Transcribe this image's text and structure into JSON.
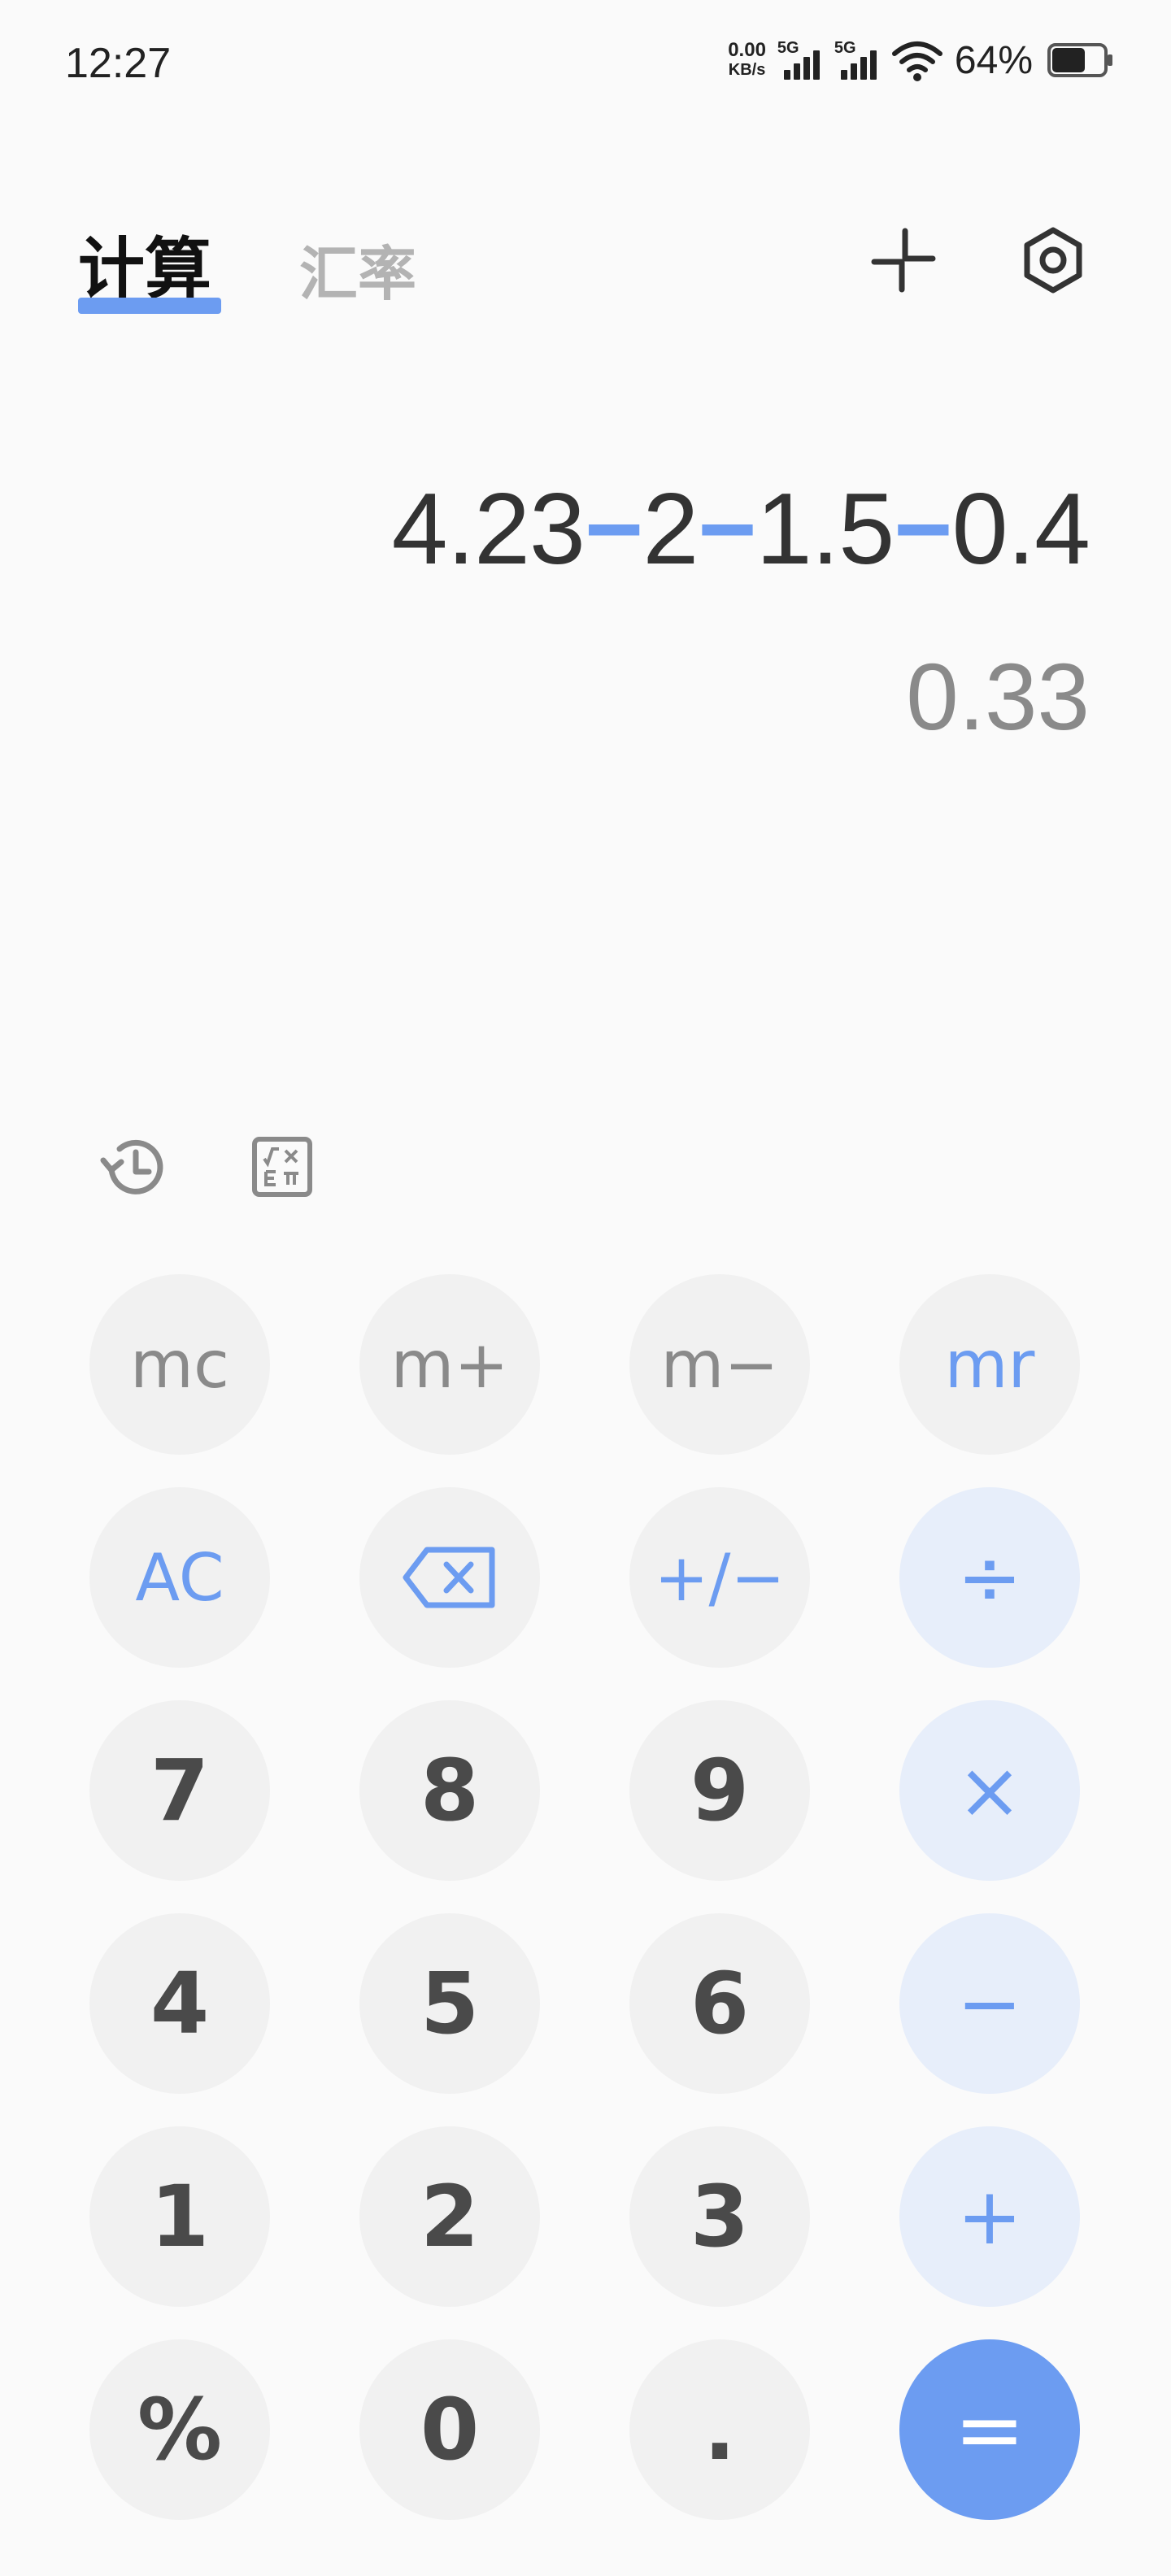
{
  "status_bar": {
    "time": "12:27",
    "net_speed_value": "0.00",
    "net_speed_unit": "KB/s",
    "sim1_label": "5G",
    "sim2_label": "5G",
    "battery_percent": "64%"
  },
  "header": {
    "tabs": [
      {
        "label": "计算",
        "active": true
      },
      {
        "label": "汇率",
        "active": false
      }
    ],
    "icons": [
      "collapse-icon",
      "settings-icon"
    ]
  },
  "display": {
    "expression_parts": [
      "4.23",
      "−",
      "2",
      "−",
      "1.5",
      "−",
      "0.4"
    ],
    "result": "0.33"
  },
  "tools": {
    "icons": [
      "history-icon",
      "scientific-mode-icon"
    ]
  },
  "keypad": {
    "memory_row": [
      "mc",
      "m+",
      "m−",
      "mr"
    ],
    "row2": {
      "clear": "AC",
      "sign": "+/−",
      "divide": "÷"
    },
    "row3": [
      "7",
      "8",
      "9",
      "×"
    ],
    "row4": [
      "4",
      "5",
      "6",
      "−"
    ],
    "row5": [
      "1",
      "2",
      "3",
      "+"
    ],
    "row6": [
      "%",
      "0",
      ".",
      "="
    ]
  },
  "colors": {
    "accent": "#6c9cf1",
    "operator_bg": "#e7eefa",
    "key_bg": "#f1f1f1",
    "background": "#fafafa"
  }
}
